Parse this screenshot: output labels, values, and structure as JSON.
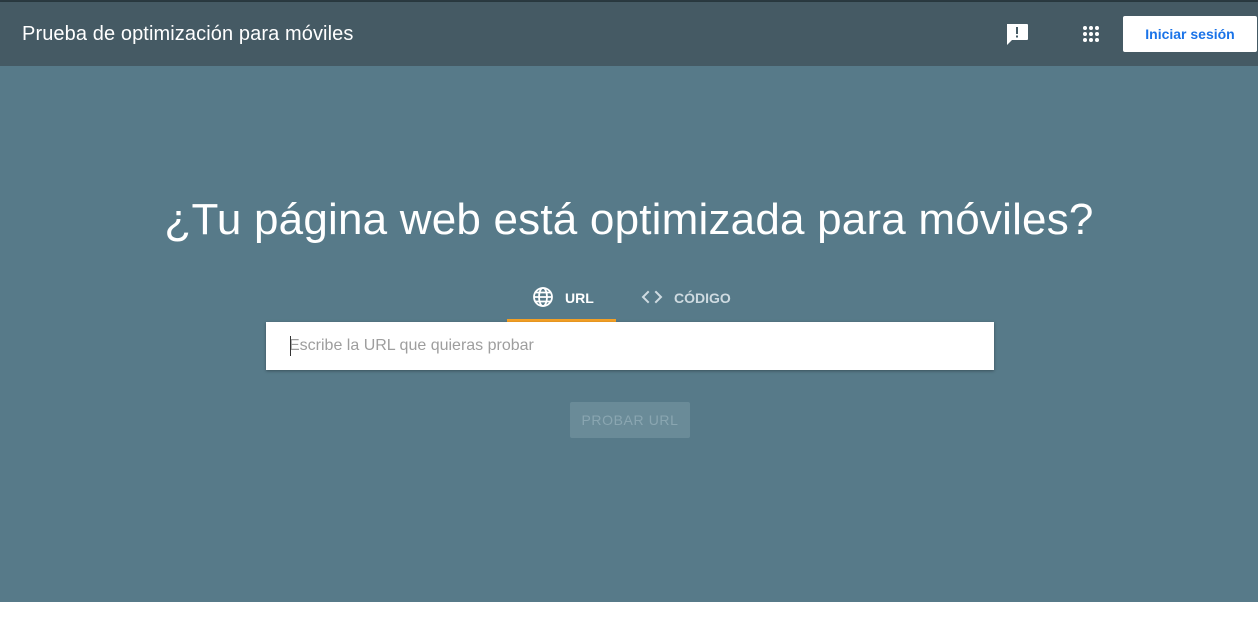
{
  "header": {
    "title": "Prueba de optimización para móviles",
    "feedback_icon": "feedback-icon",
    "apps_icon": "apps-grid-icon",
    "signin_label": "Iniciar sesión"
  },
  "hero": {
    "headline": "¿Tu página web está optimizada para móviles?",
    "tabs": [
      {
        "label": "URL",
        "icon": "globe-icon",
        "active": true
      },
      {
        "label": "CÓDIGO",
        "icon": "code-icon",
        "active": false
      }
    ],
    "url_input": {
      "placeholder": "Escribe la URL que quieras probar",
      "value": ""
    },
    "test_button_label": "PROBAR URL"
  },
  "colors": {
    "appbar": "#455a64",
    "hero": "#577a89",
    "tab_indicator": "#f4a025",
    "signin_text": "#1a73e8"
  }
}
